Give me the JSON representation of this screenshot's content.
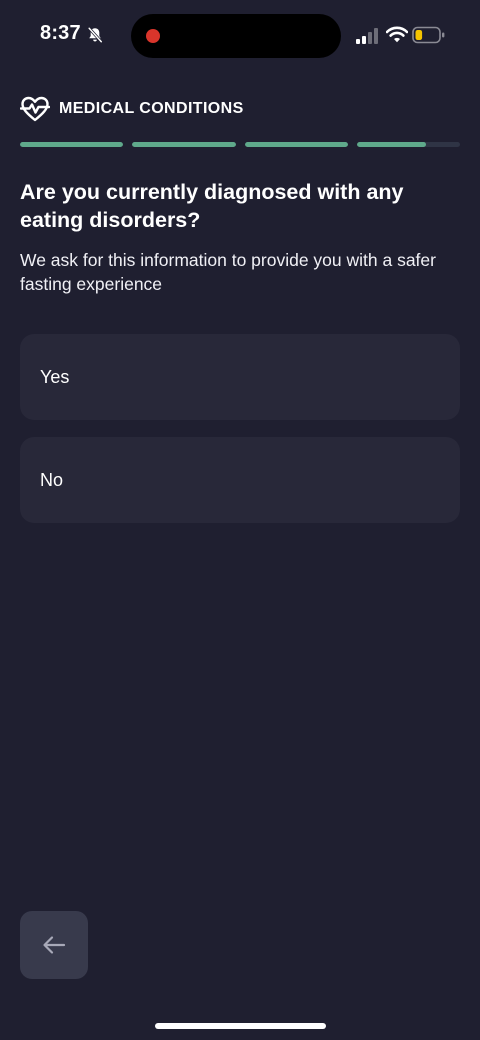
{
  "status_bar": {
    "time": "8:37",
    "icons": [
      "bell-slash-icon",
      "recording-dot",
      "cellular-signal-icon",
      "wifi-icon",
      "battery-icon"
    ],
    "battery_level": 0.3,
    "recording_color": "#d9352b",
    "battery_color": "#f5c400"
  },
  "header": {
    "icon": "heart-pulse-icon",
    "title": "MEDICAL CONDITIONS"
  },
  "progress": {
    "accent": "#5fa98b",
    "segments": [
      1,
      1,
      1,
      0.67
    ]
  },
  "question": {
    "title": "Are you currently diagnosed with any eating disorders?",
    "subtitle": "We ask for this information to provide you with a safer fasting experience"
  },
  "options": [
    {
      "label": "Yes"
    },
    {
      "label": "No"
    }
  ],
  "navigation": {
    "back_icon": "arrow-left-icon"
  }
}
